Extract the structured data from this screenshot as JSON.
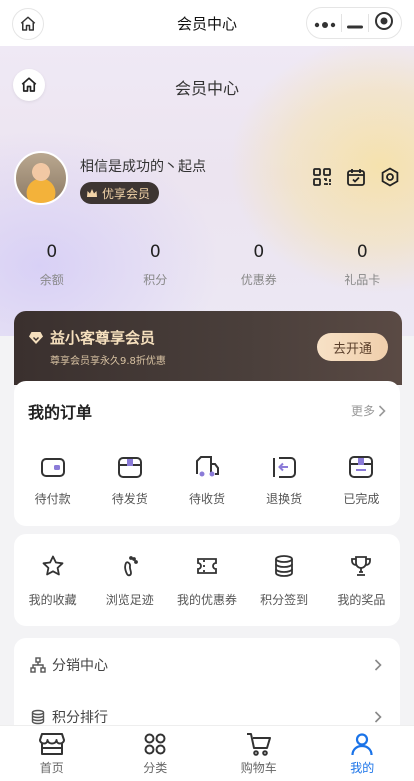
{
  "topbar": {
    "title": "会员中心"
  },
  "hero": {
    "title": "会员中心",
    "nickname": "相信是成功的丶起点",
    "vip_label": "优享会员",
    "stats": [
      {
        "value": "0",
        "label": "余额"
      },
      {
        "value": "0",
        "label": "积分"
      },
      {
        "value": "0",
        "label": "优惠券"
      },
      {
        "value": "0",
        "label": "礼品卡"
      }
    ]
  },
  "vip_banner": {
    "title": "益小客尊享会员",
    "subtitle": "尊享会员享永久9.8折优惠",
    "button": "去开通"
  },
  "orders": {
    "title": "我的订单",
    "more": "更多",
    "items": [
      {
        "label": "待付款",
        "icon": "wallet-icon"
      },
      {
        "label": "待发货",
        "icon": "package-icon"
      },
      {
        "label": "待收货",
        "icon": "truck-icon"
      },
      {
        "label": "退换货",
        "icon": "return-icon"
      },
      {
        "label": "已完成",
        "icon": "completed-box-icon"
      }
    ]
  },
  "tools": {
    "items": [
      {
        "label": "我的收藏",
        "icon": "star-icon"
      },
      {
        "label": "浏览足迹",
        "icon": "footprint-icon"
      },
      {
        "label": "我的优惠券",
        "icon": "ticket-icon"
      },
      {
        "label": "积分签到",
        "icon": "coins-icon"
      },
      {
        "label": "我的奖品",
        "icon": "trophy-icon"
      }
    ]
  },
  "menu": [
    {
      "label": "分销中心",
      "icon": "network-icon"
    },
    {
      "label": "积分排行",
      "icon": "database-icon"
    }
  ],
  "tabbar": {
    "items": [
      {
        "label": "首页",
        "icon": "shop-icon"
      },
      {
        "label": "分类",
        "icon": "grid-icon"
      },
      {
        "label": "购物车",
        "icon": "cart-icon"
      },
      {
        "label": "我的",
        "icon": "user-icon"
      }
    ],
    "active_color": "#1a73e8"
  }
}
